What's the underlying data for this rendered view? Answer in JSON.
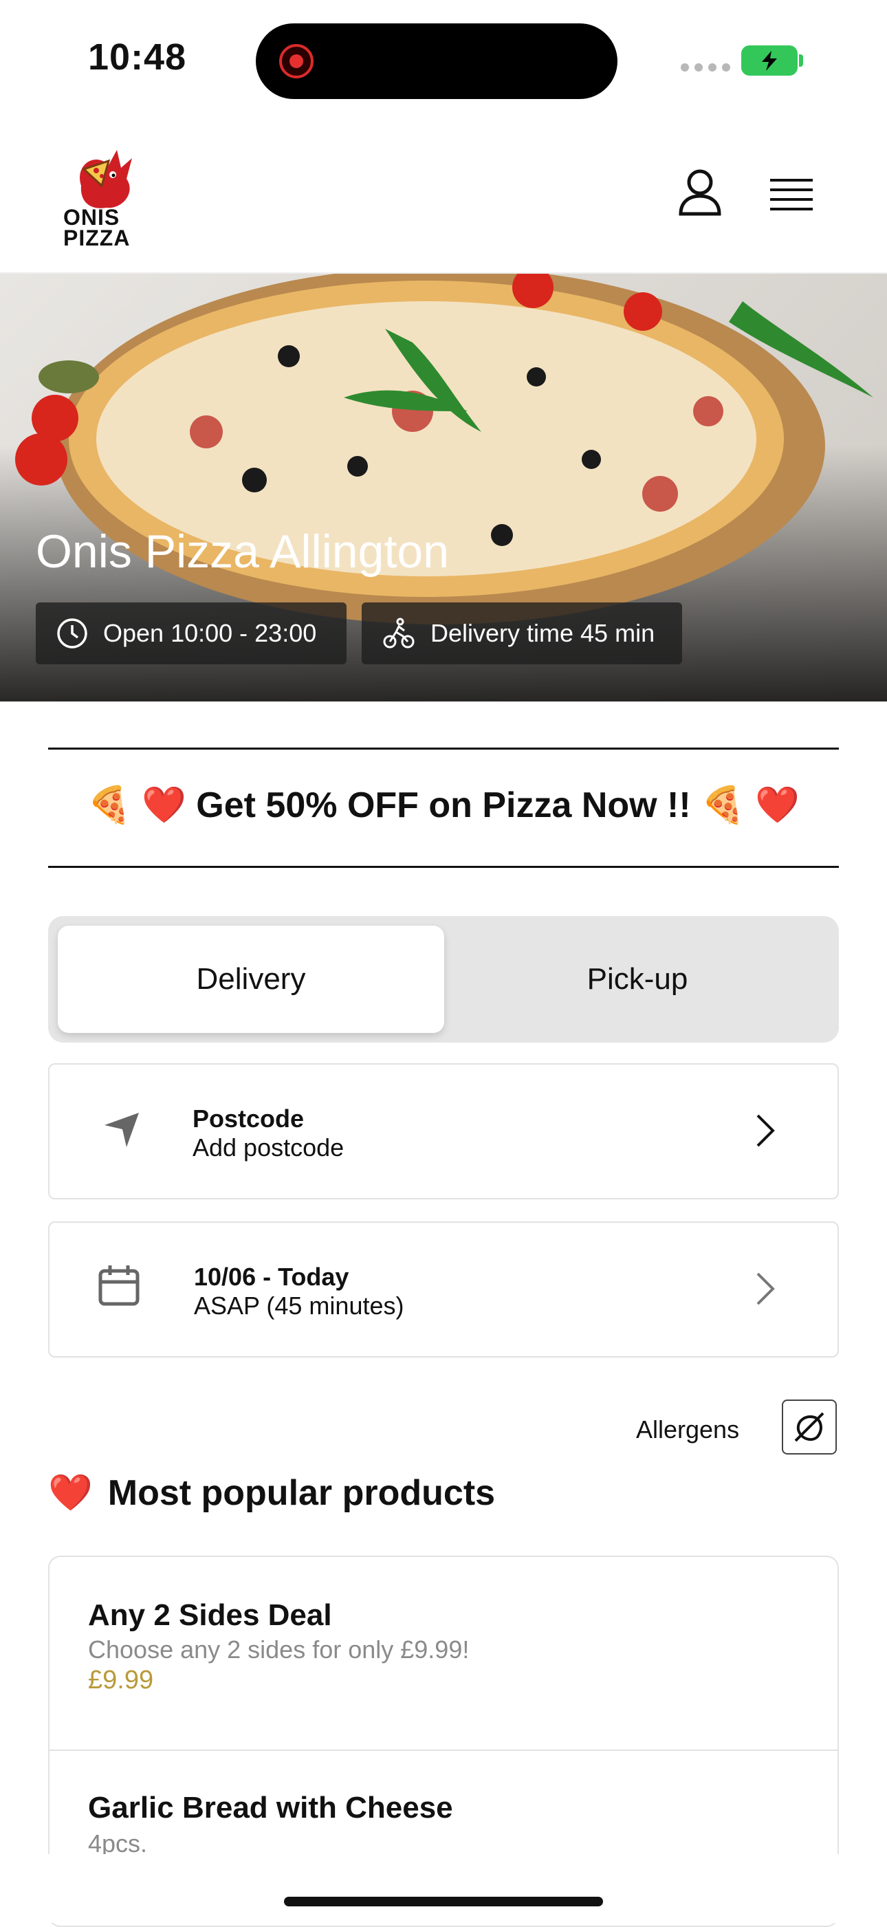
{
  "status_bar": {
    "time": "10:48"
  },
  "header": {
    "logo_top": "ONIS",
    "logo_bottom": "PIZZA"
  },
  "hero": {
    "title": "Onis Pizza Allington",
    "hours": "Open 10:00 - 23:00",
    "delivery_time": "Delivery time 45 min"
  },
  "promo": {
    "text": "🍕 ❤️ Get 50% OFF on Pizza Now !! 🍕 ❤️"
  },
  "order_type": {
    "delivery": "Delivery",
    "pickup": "Pick-up"
  },
  "postcode": {
    "title": "Postcode",
    "value": "Add postcode"
  },
  "schedule": {
    "date": "10/06 - Today",
    "time": "ASAP (45 minutes)"
  },
  "allergens": {
    "label": "Allergens"
  },
  "popular": {
    "title": "Most popular products",
    "emoji": "❤️",
    "items": [
      {
        "name": "Any 2 Sides Deal",
        "desc": "Choose any 2 sides for only £9.99!",
        "price": "£9.99"
      },
      {
        "name": "Garlic Bread with Cheese",
        "desc": "4pcs."
      }
    ]
  },
  "colors": {
    "price": "#b89a3a",
    "battery": "#33c759",
    "record": "#e53030"
  }
}
